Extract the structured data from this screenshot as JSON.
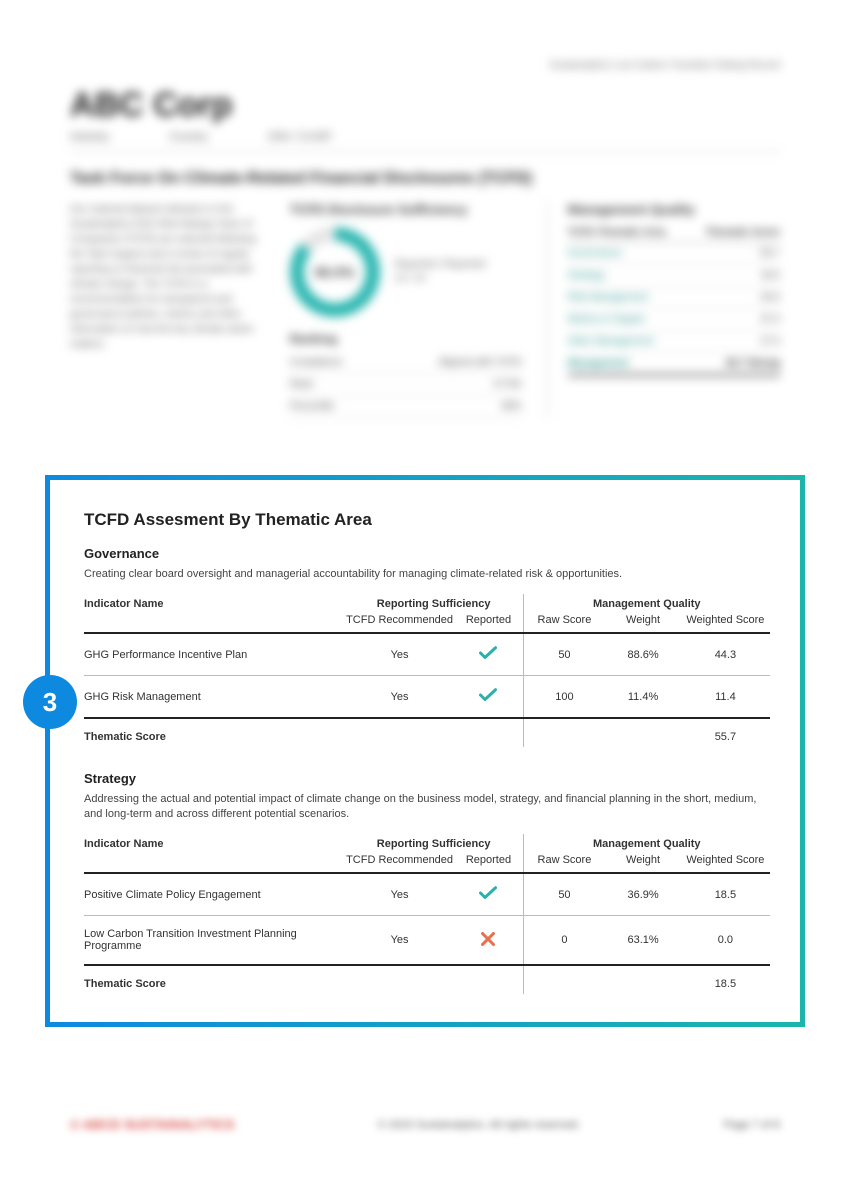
{
  "blurred": {
    "top_right": "Sustainalytics Low Carbon Transition Rating Record",
    "company": "ABC Corp",
    "meta1": "Industry",
    "meta2": "Country",
    "meta3": "ISIN / CUSIP",
    "section_title": "Task Force On Climate-Related Financial Disclosures (TCFD)",
    "desc": "Our material dataset indicators in the Sustainalytics ESG Risk Ratings Team of Companies (TCFD) are selected following the Task Support and a review of regular reporting on financial risk associated with climate change. The TCFD is a recommendation for transparent and governance policies, metrics and other information on how the key climate action matters.",
    "mid_heading": "TCFD Disclosure Sufficiency",
    "donut_value": "86.0%",
    "donut_label1": "Reported / Reported",
    "donut_label2": "12 / 14",
    "ranking": "Ranking",
    "rank_rows": [
      {
        "a": "Compliance",
        "b": "Aligned with TCFD"
      },
      {
        "a": "Rank",
        "b": "47.9%"
      },
      {
        "a": "Percentile",
        "b": "99%"
      }
    ],
    "right_heading": "Management Quality",
    "mq_head_a": "TCFD Thematic Area",
    "mq_head_b": "Thematic Score",
    "mq_rows": [
      {
        "a": "Governance",
        "b": "55.7"
      },
      {
        "a": "Strategy",
        "b": "18.5"
      },
      {
        "a": "Risk Management",
        "b": "40.6"
      },
      {
        "a": "Metrics & Targets",
        "b": "37.0"
      },
      {
        "a": "Other Management",
        "b": "27.0"
      }
    ],
    "mq_total_a": "Management",
    "mq_total_b": "45.7  Strong"
  },
  "card": {
    "badge": "3",
    "title": "TCFD Assesment By Thematic Area",
    "col_headers": {
      "indicator": "Indicator Name",
      "rep_suf": "Reporting Sufficiency",
      "mgmt_q": "Management Quality",
      "tcfd_rec": "TCFD Recommended",
      "reported": "Reported",
      "raw": "Raw Score",
      "weight": "Weight",
      "wscore": "Weighted Score"
    },
    "thematic_label": "Thematic Score",
    "themes": [
      {
        "name": "Governance",
        "desc": "Creating clear board oversight and managerial accountability for managing climate-related risk & opportunities.",
        "rows": [
          {
            "indicator": "GHG Performance Incentive Plan",
            "rec": "Yes",
            "reported": "check",
            "raw": "50",
            "weight": "88.6%",
            "wscore": "44.3"
          },
          {
            "indicator": "GHG Risk Management",
            "rec": "Yes",
            "reported": "check",
            "raw": "100",
            "weight": "11.4%",
            "wscore": "11.4"
          }
        ],
        "score": "55.7"
      },
      {
        "name": "Strategy",
        "desc": "Addressing the actual and potential impact of climate change on the business model, strategy, and financial planning in the short, medium, and long-term and across different potential scenarios.",
        "rows": [
          {
            "indicator": "Positive Climate Policy Engagement",
            "rec": "Yes",
            "reported": "check",
            "raw": "50",
            "weight": "36.9%",
            "wscore": "18.5"
          },
          {
            "indicator": "Low Carbon Transition Investment Planning Programme",
            "rec": "Yes",
            "reported": "cross",
            "raw": "0",
            "weight": "63.1%",
            "wscore": "0.0"
          }
        ],
        "score": "18.5"
      }
    ]
  },
  "footer": {
    "left": "© ABCD SUSTAINALYTICS",
    "mid": "© 2023 Sustainalytics. All rights reserved.",
    "right": "Page 7 of 8"
  }
}
